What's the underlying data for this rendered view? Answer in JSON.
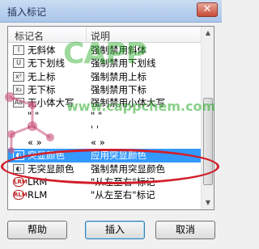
{
  "window": {
    "title": "插入标记",
    "close_glyph": "✕"
  },
  "list": {
    "headers": {
      "name": "标记名",
      "desc": "说明"
    },
    "rows": [
      {
        "icon": "italic-off-icon",
        "glyph": "I",
        "name": "无斜体",
        "desc": "强制禁用斜体",
        "selected": false
      },
      {
        "icon": "underline-off-icon",
        "glyph": "U",
        "name": "无下划线",
        "desc": "强制禁用下划线",
        "selected": false
      },
      {
        "icon": "superscript-off-icon",
        "glyph": "x²",
        "name": "无上标",
        "desc": "强制禁用上标",
        "selected": false
      },
      {
        "icon": "subscript-off-icon",
        "glyph": "x₂",
        "name": "无下标",
        "desc": "强制禁用下标",
        "selected": false
      },
      {
        "icon": "small-caps-off-icon",
        "glyph": "Aa",
        "name": "无小体大写",
        "desc": "强制禁用小体大写",
        "selected": false
      },
      {
        "icon": "",
        "glyph": "",
        "name": "\"  \"",
        "desc": "\"  \"",
        "selected": false
      },
      {
        "icon": "",
        "glyph": "",
        "name": "' '",
        "desc": "' '",
        "selected": false
      },
      {
        "icon": "",
        "glyph": "",
        "name": "«  »",
        "desc": "«  »",
        "selected": false
      },
      {
        "icon": "highlight-color-icon",
        "glyph": "◐",
        "name": "突显颜色",
        "desc": "应用突显颜色",
        "selected": true
      },
      {
        "icon": "highlight-color-off-icon",
        "glyph": "◐",
        "name": "无突显颜色",
        "desc": "强制禁用突显颜色",
        "selected": false
      },
      {
        "icon": "lrm-icon",
        "glyph": "LRM",
        "name": "LRM",
        "desc": "\"从左至右\"标记",
        "selected": false
      },
      {
        "icon": "rlm-icon",
        "glyph": "RLM",
        "name": "RLM",
        "desc": "\"从左至右\"标记",
        "selected": false
      }
    ]
  },
  "scrollbar": {
    "up_glyph": "▲",
    "down_glyph": "▼"
  },
  "watermark": {
    "logo": "CAPP",
    "url": "www.cappchem.com"
  },
  "buttons": {
    "help": "帮助",
    "insert": "插入",
    "cancel": "取消"
  },
  "colors": {
    "selection": "#3399ff",
    "annotation": "#d21e2a",
    "watermark": "#28aa28"
  }
}
